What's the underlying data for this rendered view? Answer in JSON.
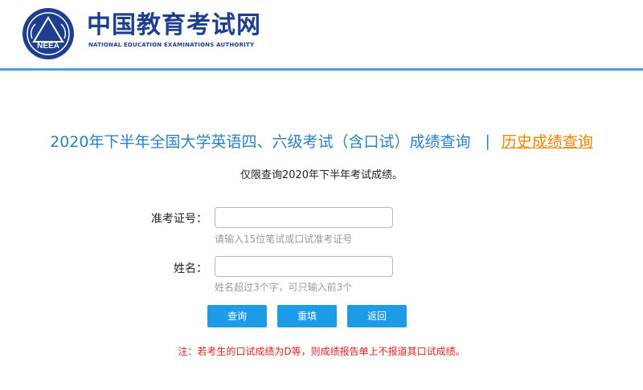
{
  "header": {
    "logo_cn": "中国教育考试网",
    "logo_en": "NATIONAL EDUCATION EXAMINATIONS AUTHORITY",
    "emblem_text": "NEEA"
  },
  "page": {
    "title": "2020年下半年全国大学英语四、六级考试（含口试）成绩查询",
    "separator": "|",
    "history_link": "历史成绩查询",
    "notice": "仅限查询2020年下半年考试成绩。"
  },
  "form": {
    "exam_id": {
      "label": "准考证号：",
      "value": "",
      "hint": "请输入15位笔试或口试准考证号"
    },
    "name": {
      "label": "姓名：",
      "value": "",
      "hint": "姓名超过3个字，可只输入前3个"
    },
    "buttons": {
      "query": "查询",
      "reset": "重填",
      "back": "返回"
    }
  },
  "footer": {
    "warning": "注：若考生的口试成绩为D等，则成绩报告单上不报道其口试成绩。"
  },
  "colors": {
    "brand_blue": "#1e3f8f",
    "title_blue": "#2a7fc1",
    "button_blue": "#1e9be6",
    "link_orange": "#f08300",
    "warning_red": "#e02020"
  }
}
